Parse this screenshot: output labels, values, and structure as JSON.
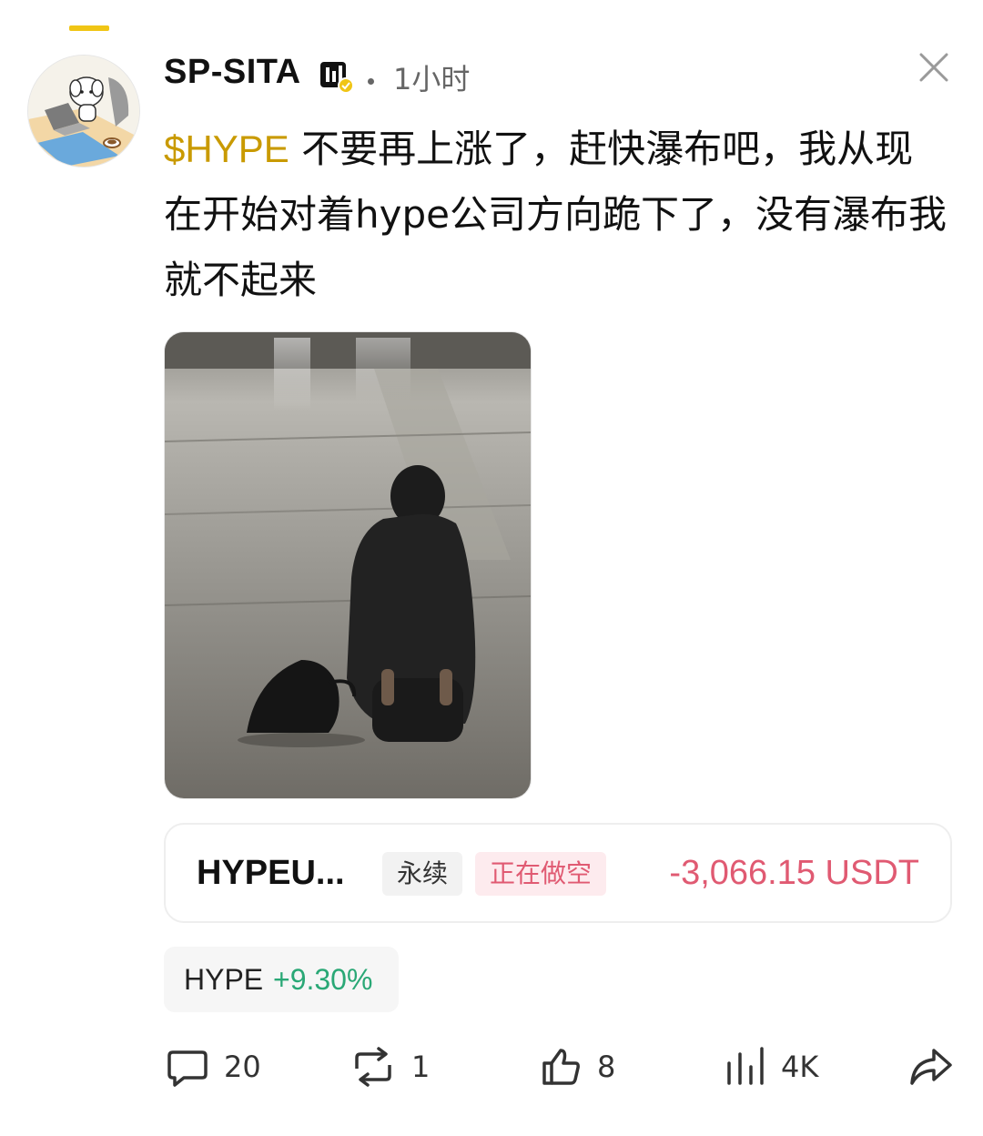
{
  "post": {
    "author": "SP-SITA",
    "time": "1小时",
    "ticker": "$HYPE",
    "text": " 不要再上涨了，赶快瀑布吧，我从现在开始对着hype公司方向跪下了，没有瀑布我就不起来"
  },
  "position": {
    "symbol": "HYPEU...",
    "type_tag": "永续",
    "side_tag": "正在做空",
    "pnl": "-3,066.15 USDT"
  },
  "ticker_chip": {
    "name": "HYPE",
    "change": "+9.30%"
  },
  "actions": {
    "comments": "20",
    "reposts": "1",
    "likes": "8",
    "views": "4K"
  },
  "colors": {
    "accent_yellow": "#f0c515",
    "ticker_gold": "#c99a00",
    "short_red": "#e05a72",
    "gain_green": "#2aa876"
  }
}
